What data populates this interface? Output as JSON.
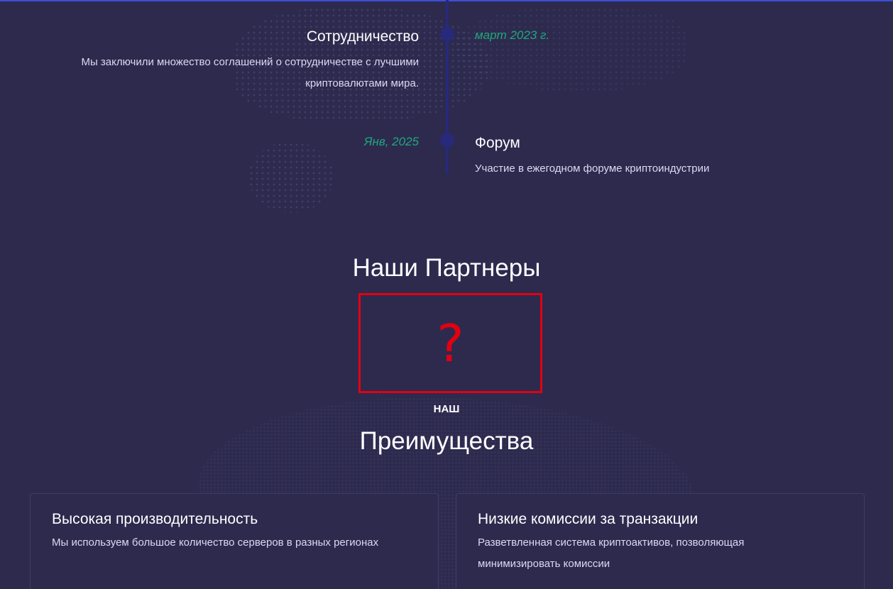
{
  "timeline": [
    {
      "title": "Сотрудничество",
      "date": "март 2023 г.",
      "description_line1": "Мы заключили множество соглашений о сотрудничестве с лучшими",
      "description_line2": "криптовалютами мира."
    },
    {
      "title": "Форум",
      "date": "Янв, 2025",
      "description": "Участие в ежегодном форуме криптоиндустрии"
    }
  ],
  "partners": {
    "title": "Наши Партнеры",
    "placeholder_glyph": "?"
  },
  "advantages": {
    "eyebrow": "НАШ",
    "title": "Преимущества",
    "cards": [
      {
        "title": "Высокая производительность",
        "text_line1": "Мы используем большое количество серверов в разных регионах"
      },
      {
        "title": "Низкие комиссии за транзакции",
        "text_line1": "Разветвленная система криптоактивов, позволяющая",
        "text_line2": "минимизировать комиссии"
      }
    ]
  },
  "colors": {
    "background": "#2d2a4e",
    "accent_green": "#1fa87a",
    "timeline": "#27297a",
    "placeholder_red": "#e3000f"
  }
}
